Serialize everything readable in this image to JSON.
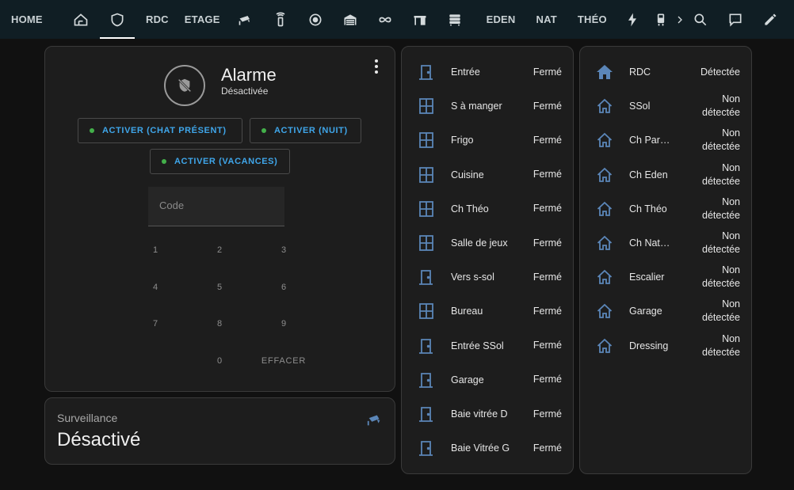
{
  "topbar": {
    "tabs": [
      {
        "type": "text",
        "label": "HOME"
      },
      {
        "type": "icon",
        "icon": "home-floorplan-icon"
      },
      {
        "type": "icon",
        "icon": "shield-outline-icon",
        "active": true
      },
      {
        "type": "text",
        "label": "RDC"
      },
      {
        "type": "text",
        "label": "ETAGE"
      },
      {
        "type": "icon",
        "icon": "cctv-icon"
      },
      {
        "type": "icon",
        "icon": "remote-icon"
      },
      {
        "type": "icon",
        "icon": "robot-vacuum-icon"
      },
      {
        "type": "icon",
        "icon": "garage-icon"
      },
      {
        "type": "icon",
        "icon": "infinity-icon"
      },
      {
        "type": "icon",
        "icon": "desk-icon"
      },
      {
        "type": "icon",
        "icon": "dresser-icon"
      },
      {
        "type": "text",
        "label": "EDEN"
      },
      {
        "type": "text",
        "label": "NAT"
      },
      {
        "type": "text",
        "label": "THÉO"
      },
      {
        "type": "icon",
        "icon": "flash-icon"
      },
      {
        "type": "icon",
        "icon": "train-icon"
      }
    ],
    "right_icons": [
      "search-icon",
      "message-icon",
      "pencil-icon"
    ]
  },
  "alarm": {
    "title": "Alarme",
    "state": "Désactivée",
    "buttons": [
      "ACTIVER (CHAT PRÉSENT)",
      "ACTIVER (NUIT)",
      "ACTIVER (VACANCES)"
    ],
    "code_placeholder": "Code",
    "keys": [
      "1",
      "2",
      "3",
      "4",
      "5",
      "6",
      "7",
      "8",
      "9",
      "0",
      "EFFACER"
    ]
  },
  "surveillance": {
    "label": "Surveillance",
    "value": "Désactivé"
  },
  "doors": [
    {
      "icon": "door-icon",
      "name": "Entrée",
      "state": "Fermé"
    },
    {
      "icon": "window-icon",
      "name": "S à manger",
      "state": "Fermé"
    },
    {
      "icon": "window-icon",
      "name": "Frigo",
      "state": "Fermé"
    },
    {
      "icon": "window-icon",
      "name": "Cuisine",
      "state": "Fermé"
    },
    {
      "icon": "window-icon",
      "name": "Ch Théo",
      "state": "Fermé"
    },
    {
      "icon": "window-icon",
      "name": "Salle de jeux",
      "state": "Fermé"
    },
    {
      "icon": "door-icon",
      "name": "Vers s-sol",
      "state": "Fermé"
    },
    {
      "icon": "window-icon",
      "name": "Bureau",
      "state": "Fermé"
    },
    {
      "icon": "door-icon",
      "name": "Entrée SSol",
      "state": "Fermé"
    },
    {
      "icon": "door-icon",
      "name": "Garage",
      "state": "Fermé"
    },
    {
      "icon": "door-icon",
      "name": "Baie vitrée D",
      "state": "Fermé"
    },
    {
      "icon": "door-icon",
      "name": "Baie Vitrée G",
      "state": "Fermé"
    }
  ],
  "motion": [
    {
      "icon": "home-filled-icon",
      "name": "RDC",
      "state": "Détectée"
    },
    {
      "icon": "home-outline-icon",
      "name": "SSol",
      "state": "Non détectée"
    },
    {
      "icon": "home-outline-icon",
      "name": "Ch Parents",
      "state": "Non détectée"
    },
    {
      "icon": "home-outline-icon",
      "name": "Ch Eden",
      "state": "Non détectée"
    },
    {
      "icon": "home-outline-icon",
      "name": "Ch Théo",
      "state": "Non détectée"
    },
    {
      "icon": "home-outline-icon",
      "name": "Ch Nathan",
      "state": "Non détectée"
    },
    {
      "icon": "home-outline-icon",
      "name": "Escalier",
      "state": "Non détectée"
    },
    {
      "icon": "home-outline-icon",
      "name": "Garage",
      "state": "Non détectée"
    },
    {
      "icon": "home-outline-icon",
      "name": "Dressing",
      "state": "Non détectée"
    }
  ],
  "colors": {
    "accent": "#3fa6ea",
    "state_icon": "#5b86b8",
    "armed_dot": "#43b04a",
    "topbar": "#101e24"
  }
}
